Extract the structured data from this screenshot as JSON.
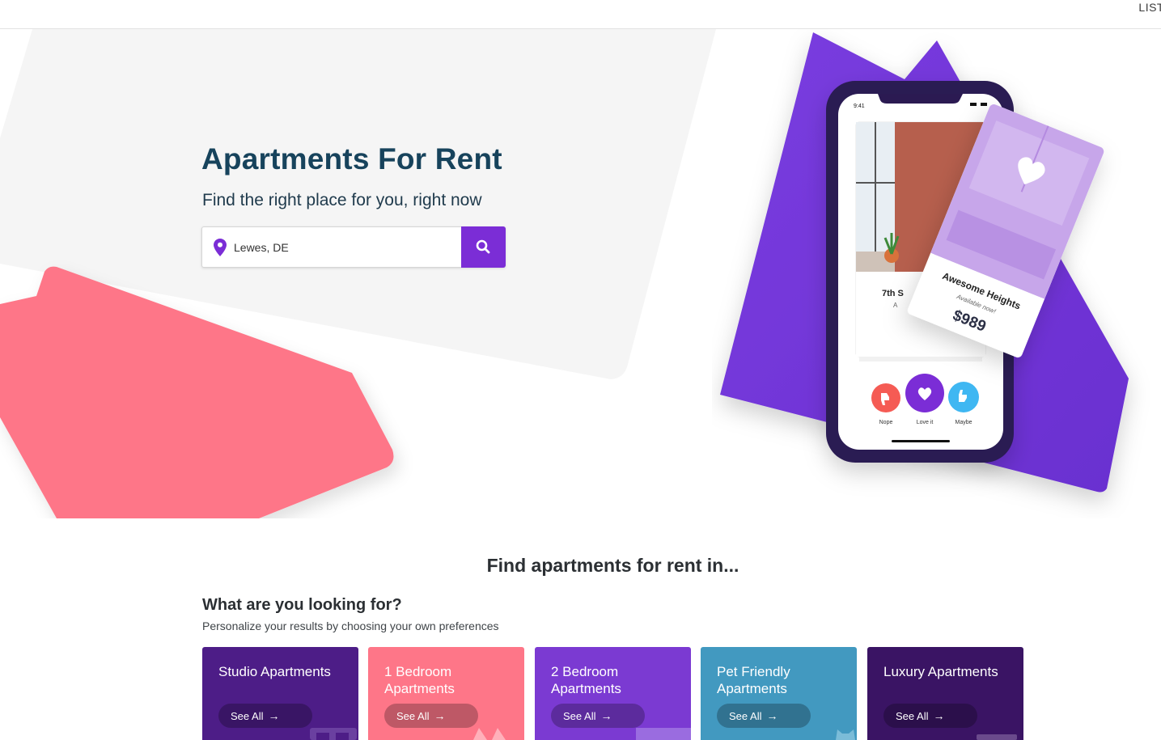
{
  "topbar": {
    "list_link": "LIST"
  },
  "hero": {
    "title": "Apartments For Rent",
    "subtitle": "Find the right place for you, right now",
    "search": {
      "value": "Lewes, DE"
    }
  },
  "phone": {
    "status_time": "9:41",
    "listing_back_title": "7th S",
    "listing_back_sub": "A",
    "listing_title": "Awesome Heights",
    "listing_status": "Available now!",
    "listing_price": "$989",
    "actions": [
      {
        "label": "Nope",
        "color": "#f55b54",
        "icon": "thumbs-down-icon"
      },
      {
        "label": "Love it",
        "color": "#7b2dd6",
        "icon": "heart-icon"
      },
      {
        "label": "Maybe",
        "color": "#3fb7f2",
        "icon": "thumbs-up-icon"
      }
    ]
  },
  "section": {
    "title": "Find apartments for rent in...",
    "looking_title": "What are you looking for?",
    "looking_sub": "Personalize your results by choosing your own preferences"
  },
  "cards": [
    {
      "title": "Studio Apartments",
      "see_all": "See All",
      "color": "#4d1d87"
    },
    {
      "title": "1 Bedroom Apartments",
      "see_all": "See All",
      "color": "#fe7688"
    },
    {
      "title": "2 Bedroom Apartments",
      "see_all": "See All",
      "color": "#7b3ad2"
    },
    {
      "title": "Pet Friendly Apartments",
      "see_all": "See All",
      "color": "#4299c0"
    },
    {
      "title": "Luxury Apartments",
      "see_all": "See All",
      "color": "#3a1464"
    }
  ]
}
